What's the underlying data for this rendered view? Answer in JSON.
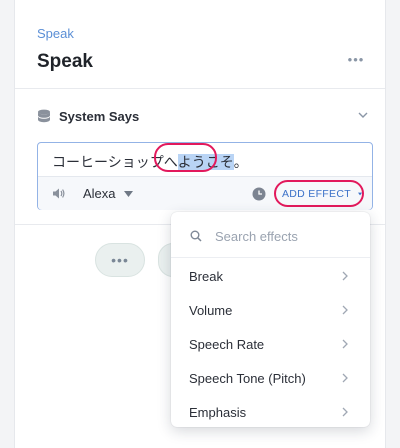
{
  "header": {
    "breadcrumb": "Speak",
    "title": "Speak",
    "more_label": "•••"
  },
  "section": {
    "title": "System Says",
    "icon": "database-icon"
  },
  "editor": {
    "text_before": "コーヒーショップへ",
    "text_selected": "ようこそ",
    "text_after": "。",
    "voice": "Alexa",
    "add_effect_label": "ADD EFFECT"
  },
  "actions": {
    "more_label": "•••"
  },
  "effects_menu": {
    "search_placeholder": "Search effects",
    "items": [
      {
        "label": "Break"
      },
      {
        "label": "Volume"
      },
      {
        "label": "Speech Rate"
      },
      {
        "label": "Speech Tone (Pitch)"
      },
      {
        "label": "Emphasis"
      }
    ]
  },
  "colors": {
    "accent": "#3c72c9",
    "highlight_ring": "#e2195c",
    "selection": "#b9d4f5"
  }
}
